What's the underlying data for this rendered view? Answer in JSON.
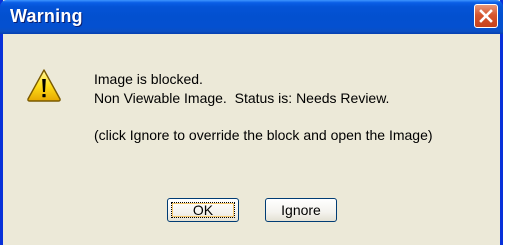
{
  "window": {
    "title": "Warning",
    "close_icon": "close-icon"
  },
  "dialog": {
    "icon": "warning-icon",
    "line1": "Image is blocked.",
    "line2": "Non Viewable Image.  Status is: Needs Review.",
    "line3": "(click Ignore to override the block and open the Image)"
  },
  "buttons": {
    "ok_label": "OK",
    "ignore_label": "Ignore",
    "ignore_accel": "I"
  },
  "colors": {
    "titlebar": "#0450d0",
    "frame": "#0831d9",
    "body": "#ece9d8",
    "close_button": "#d6562f",
    "warning_yellow": "#ffd800"
  }
}
